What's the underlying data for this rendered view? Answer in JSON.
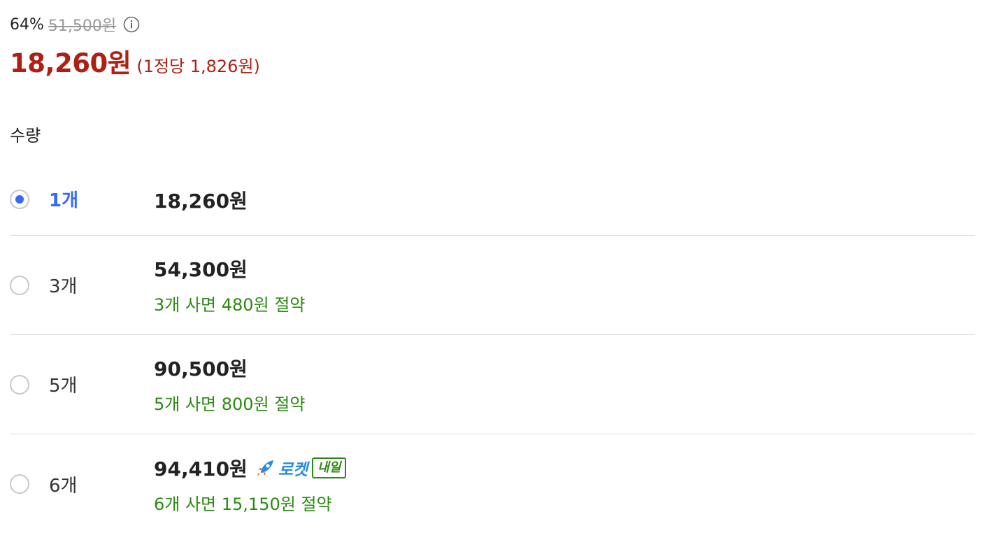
{
  "price": {
    "discount_rate": "64%",
    "original_price": "51,500원",
    "sale_price": "18,260원",
    "unit_price": "(1정당 1,826원)"
  },
  "quantity_section": {
    "title": "수량",
    "options": [
      {
        "label": "1개",
        "price": "18,260원",
        "saving": "",
        "selected": true
      },
      {
        "label": "3개",
        "price": "54,300원",
        "saving": "3개 사면 480원 절약",
        "selected": false
      },
      {
        "label": "5개",
        "price": "90,500원",
        "saving": "5개 사면 800원 절약",
        "selected": false
      },
      {
        "label": "6개",
        "price": "94,410원",
        "saving": "6개 사면 15,150원 절약",
        "selected": false,
        "delivery": {
          "icon": "rocket-icon",
          "text": "로켓",
          "badge": "내일"
        }
      }
    ]
  },
  "colors": {
    "sale_red": "#ae2012",
    "selected_blue": "#346aff",
    "saving_green": "#2b8a12",
    "rocket_blue": "#2a8ce0"
  }
}
